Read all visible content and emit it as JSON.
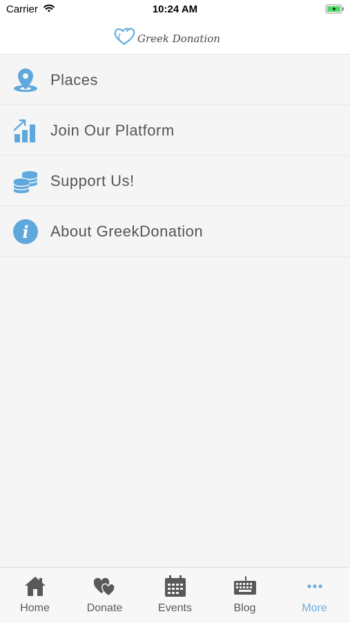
{
  "status_bar": {
    "carrier": "Carrier",
    "time": "10:24 AM"
  },
  "header": {
    "logo_text": "Greek Donation"
  },
  "menu": {
    "items": [
      {
        "label": "Places",
        "icon": "map-pin-icon"
      },
      {
        "label": "Join Our Platform",
        "icon": "chart-growth-icon"
      },
      {
        "label": "Support Us!",
        "icon": "coins-icon"
      },
      {
        "label": "About GreekDonation",
        "icon": "info-icon"
      }
    ]
  },
  "tab_bar": {
    "tabs": [
      {
        "label": "Home",
        "icon": "home-icon"
      },
      {
        "label": "Donate",
        "icon": "hearts-icon"
      },
      {
        "label": "Events",
        "icon": "calendar-icon"
      },
      {
        "label": "Blog",
        "icon": "keyboard-icon"
      },
      {
        "label": "More",
        "icon": "more-dots-icon",
        "active": true
      }
    ]
  },
  "colors": {
    "accent": "#6aaedc",
    "icon_blue": "#5fa8dc",
    "text": "#555555",
    "tab_icon": "#595959",
    "background": "#f5f5f5"
  }
}
